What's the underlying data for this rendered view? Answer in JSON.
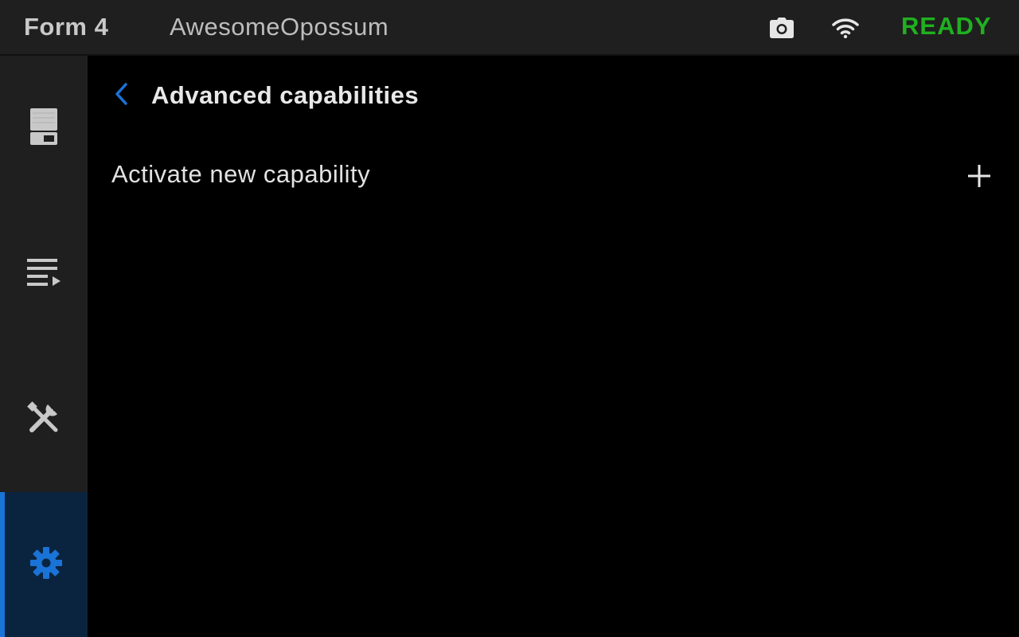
{
  "topbar": {
    "model": "Form 4",
    "printer_name": "AwesomeOpossum",
    "camera_icon": "camera-icon",
    "wifi_icon": "wifi-icon",
    "status": "READY",
    "status_color": "#20b020"
  },
  "sidebar": {
    "items": [
      {
        "name": "printer",
        "icon": "printer-icon",
        "active": false
      },
      {
        "name": "queue",
        "icon": "queue-icon",
        "active": false
      },
      {
        "name": "tools",
        "icon": "tools-icon",
        "active": false
      },
      {
        "name": "settings",
        "icon": "gear-icon",
        "active": true
      }
    ],
    "active_color": "#1a73d6"
  },
  "main": {
    "title": "Advanced capabilities",
    "back_icon": "chevron-left-icon",
    "rows": [
      {
        "label": "Activate new capability",
        "icon": "plus-icon"
      }
    ]
  }
}
